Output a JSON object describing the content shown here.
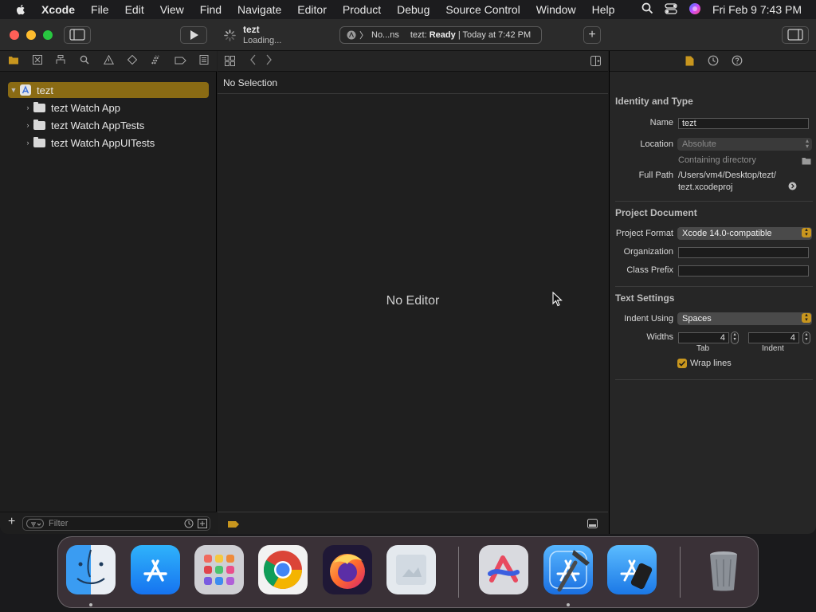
{
  "menubar": {
    "app_name": "Xcode",
    "items": [
      "File",
      "Edit",
      "View",
      "Find",
      "Navigate",
      "Editor",
      "Product",
      "Debug",
      "Source Control",
      "Window",
      "Help"
    ],
    "clock": "Fri Feb 9  7:43 PM"
  },
  "toolbar": {
    "project_title": "tezt",
    "status_subtitle": "Loading...",
    "scheme": "No...ns",
    "status_label": "tezt:",
    "status_state": "Ready",
    "status_time": "| Today at 7:42 PM"
  },
  "navigator": {
    "root": "tezt",
    "items": [
      "tezt Watch App",
      "tezt Watch AppTests",
      "tezt Watch AppUITests"
    ],
    "filter_placeholder": "Filter"
  },
  "editor": {
    "jumpbar": "No Selection",
    "placeholder": "No Editor"
  },
  "inspector": {
    "identity": {
      "title": "Identity and Type",
      "name_label": "Name",
      "name_value": "tezt",
      "location_label": "Location",
      "location_value": "Absolute",
      "containing_directory": "Containing directory",
      "full_path_label": "Full Path",
      "full_path_line1": "/Users/vm4/Desktop/tezt/",
      "full_path_line2": "tezt.xcodeproj"
    },
    "project_document": {
      "title": "Project Document",
      "format_label": "Project Format",
      "format_value": "Xcode 14.0-compatible",
      "organization_label": "Organization",
      "organization_value": "",
      "class_prefix_label": "Class Prefix",
      "class_prefix_value": ""
    },
    "text_settings": {
      "title": "Text Settings",
      "indent_using_label": "Indent Using",
      "indent_using_value": "Spaces",
      "widths_label": "Widths",
      "tab_value": "4",
      "indent_value": "4",
      "tab_caption": "Tab",
      "indent_caption": "Indent",
      "wrap_lines_label": "Wrap lines",
      "wrap_lines_checked": true
    }
  },
  "colors": {
    "accent": "#c8961e",
    "selection": "#8a6b14",
    "close": "#ff5f57",
    "minimize": "#febc2e",
    "zoom": "#28c840"
  },
  "dock": {
    "apps": [
      "finder-icon",
      "app-store-icon",
      "launchpad-icon",
      "chrome-icon",
      "firefox-icon",
      "preview-icon",
      "arc-icon",
      "xcode-icon",
      "simulator-icon",
      "trash-icon"
    ]
  }
}
